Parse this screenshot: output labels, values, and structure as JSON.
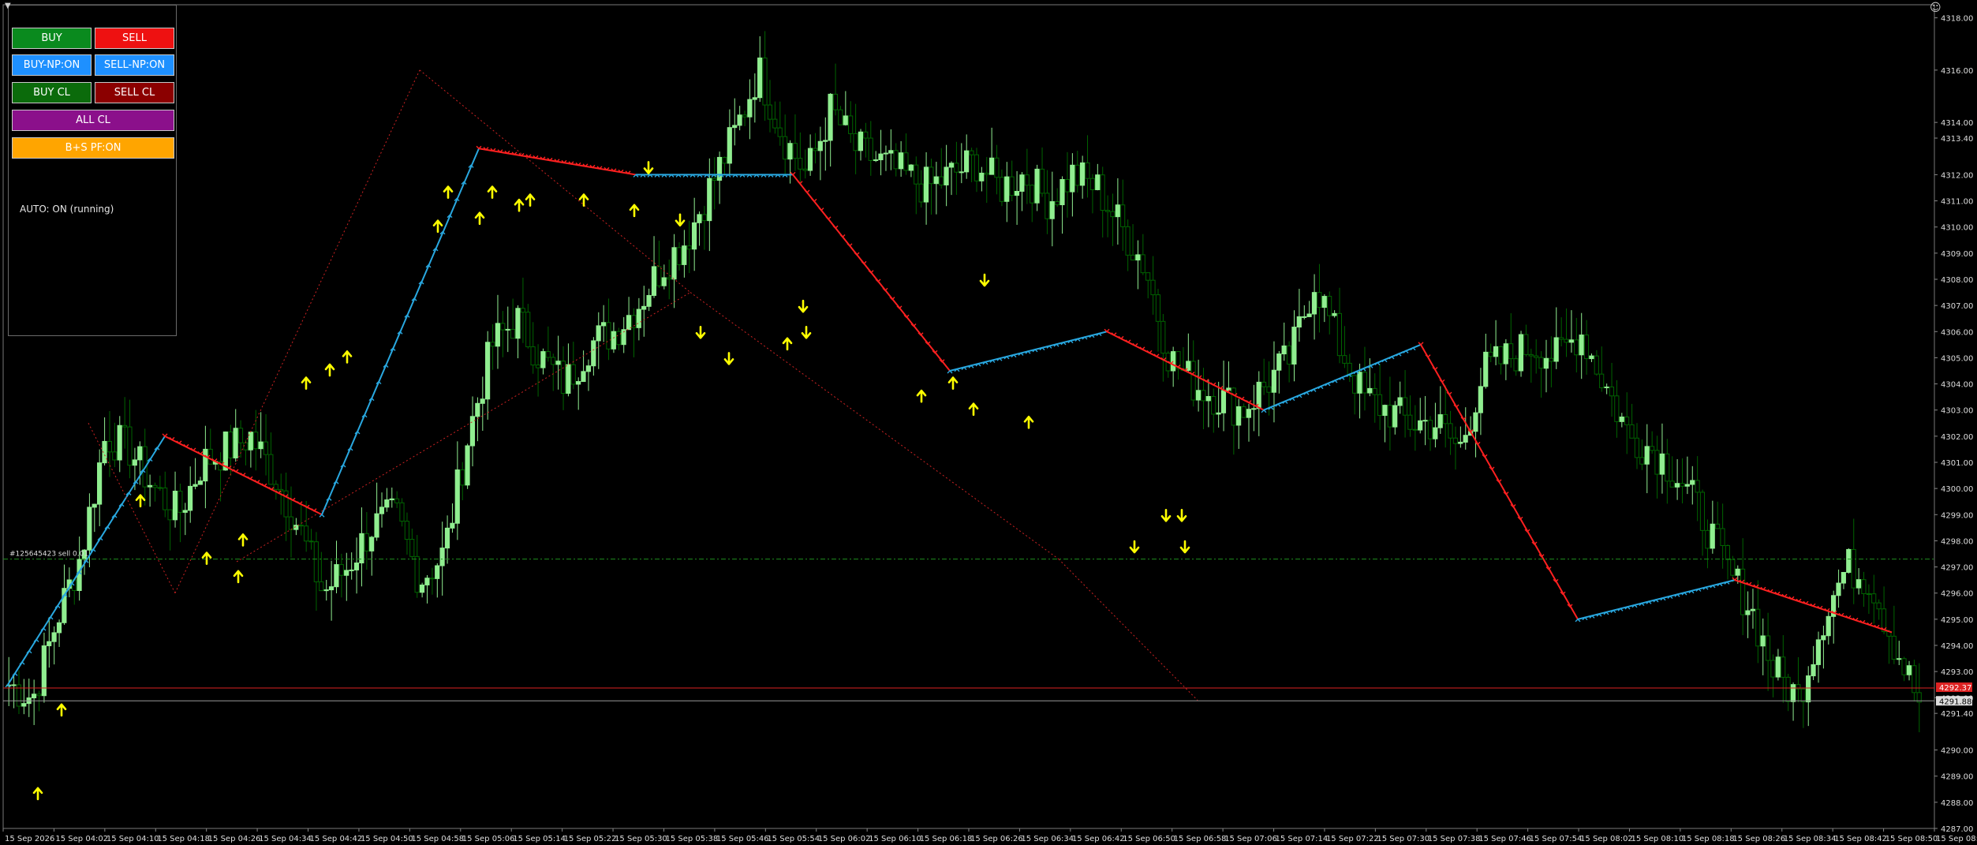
{
  "window": {
    "symbol_marker": "▼",
    "smiley_icon": "☺"
  },
  "panel": {
    "buttons": [
      {
        "id": "buy",
        "label": "BUY",
        "color": "#0a8a1e"
      },
      {
        "id": "sell",
        "label": "SELL",
        "color": "#ee1111"
      },
      {
        "id": "buy_np",
        "label": "BUY-NP:ON",
        "color": "#1e90ff"
      },
      {
        "id": "sell_np",
        "label": "SELL-NP:ON",
        "color": "#1e90ff"
      },
      {
        "id": "buy_cl",
        "label": "BUY CL",
        "color": "#0b6b0b"
      },
      {
        "id": "sell_cl",
        "label": "SELL CL",
        "color": "#8b0000"
      },
      {
        "id": "all_cl",
        "label": "ALL CL",
        "color": "#8b108b"
      },
      {
        "id": "bs_pf",
        "label": "B+S PF:ON",
        "color": "#ffa500"
      }
    ],
    "status": "AUTO: ON (running)"
  },
  "order_line_label": "#125645423 sell 0.01",
  "price_axis": {
    "labels": [
      "4318.00",
      "4316.00",
      "4314.00",
      "4313.40",
      "4312.00",
      "4311.00",
      "4310.00",
      "4309.00",
      "4308.00",
      "4307.00",
      "4306.00",
      "4305.00",
      "4304.00",
      "4303.00",
      "4302.00",
      "4301.00",
      "4300.00",
      "4299.00",
      "4298.00",
      "4297.00",
      "4296.00",
      "4295.00",
      "4294.00",
      "4293.00",
      "4292.00",
      "4291.40",
      "4290.00",
      "4289.00",
      "4288.00",
      "4287.00"
    ],
    "current_price": "4291.88",
    "sell_price_tag": "4292.37"
  },
  "time_axis": {
    "labels": [
      "15 Sep 2026",
      "15 Sep 04:02",
      "15 Sep 04:10",
      "15 Sep 04:18",
      "15 Sep 04:26",
      "15 Sep 04:34",
      "15 Sep 04:42",
      "15 Sep 04:50",
      "15 Sep 04:58",
      "15 Sep 05:06",
      "15 Sep 05:14",
      "15 Sep 05:22",
      "15 Sep 05:30",
      "15 Sep 05:38",
      "15 Sep 05:46",
      "15 Sep 05:54",
      "15 Sep 06:02",
      "15 Sep 06:10",
      "15 Sep 06:18",
      "15 Sep 06:26",
      "15 Sep 06:34",
      "15 Sep 06:42",
      "15 Sep 06:50",
      "15 Sep 06:58",
      "15 Sep 07:06",
      "15 Sep 07:14",
      "15 Sep 07:22",
      "15 Sep 07:30",
      "15 Sep 07:38",
      "15 Sep 07:46",
      "15 Sep 07:54",
      "15 Sep 08:02",
      "15 Sep 08:10",
      "15 Sep 08:18",
      "15 Sep 08:26",
      "15 Sep 08:34",
      "15 Sep 08:42",
      "15 Sep 08:50",
      "15 Sep 08:58"
    ]
  },
  "chart_data": {
    "type": "candlestick",
    "symbol_hint": "XAU",
    "ylim": [
      4287.0,
      4318.5
    ],
    "close_path": [
      4292.5,
      4292.0,
      4295.0,
      4297.5,
      4302.0,
      4301.5,
      4300.0,
      4299.0,
      4301.0,
      4301.5,
      4302.0,
      4300.5,
      4298.5,
      4296.0,
      4297.0,
      4298.5,
      4299.0,
      4296.5,
      4297.5,
      4302.0,
      4305.5,
      4306.5,
      4305.0,
      4304.0,
      4305.5,
      4306.0,
      4307.0,
      4308.5,
      4309.5,
      4311.5,
      4313.5,
      4316.0,
      4313.5,
      4312.0,
      4314.5,
      4313.0,
      4312.5,
      4312.0,
      4311.5,
      4312.0,
      4312.5,
      4311.5,
      4312.0,
      4311.0,
      4312.0,
      4311.5,
      4310.0,
      4308.5,
      4305.0,
      4304.0,
      4303.5,
      4303.0,
      4304.0,
      4305.0,
      4308.0,
      4305.5,
      4303.5,
      4303.0,
      4302.5,
      4302.5,
      4301.5,
      4304.5,
      4305.0,
      4305.5,
      4305.0,
      4306.0,
      4304.0,
      4302.0,
      4301.5,
      4300.5,
      4299.0,
      4297.0,
      4295.5,
      4293.0,
      4292.0,
      4295.0,
      4297.0,
      4296.5,
      4294.0,
      4291.8
    ],
    "trail_line": {
      "up_color": "#29a8e0",
      "down_color": "#ff2020",
      "segments": [
        {
          "dir": "up",
          "from": 4292.5,
          "to": 4302.0
        },
        {
          "dir": "down",
          "from": 4302.0,
          "to": 4299.0
        },
        {
          "dir": "up",
          "from": 4299.0,
          "to": 4313.0
        },
        {
          "dir": "down",
          "from": 4313.0,
          "to": 4312.0
        },
        {
          "dir": "up",
          "from": 4312.0,
          "to": 4312.0
        },
        {
          "dir": "down",
          "from": 4312.0,
          "to": 4304.5
        },
        {
          "dir": "up",
          "from": 4304.5,
          "to": 4306.0
        },
        {
          "dir": "down",
          "from": 4306.0,
          "to": 4303.0
        },
        {
          "dir": "up",
          "from": 4303.0,
          "to": 4305.5
        },
        {
          "dir": "down",
          "from": 4305.5,
          "to": 4295.0
        },
        {
          "dir": "up",
          "from": 4295.0,
          "to": 4296.5
        },
        {
          "dir": "down",
          "from": 4296.5,
          "to": 4294.5
        }
      ]
    },
    "levels": {
      "order_line": 4297.3,
      "sell_line": 4292.37,
      "bid_line": 4291.88
    },
    "colors": {
      "bull": "#90ee90",
      "bear": "#006400",
      "arrow": "#ffff00",
      "order_line": "#1f8f1f",
      "sell_line": "#dd2222",
      "zigzag": "#cc2222"
    }
  }
}
